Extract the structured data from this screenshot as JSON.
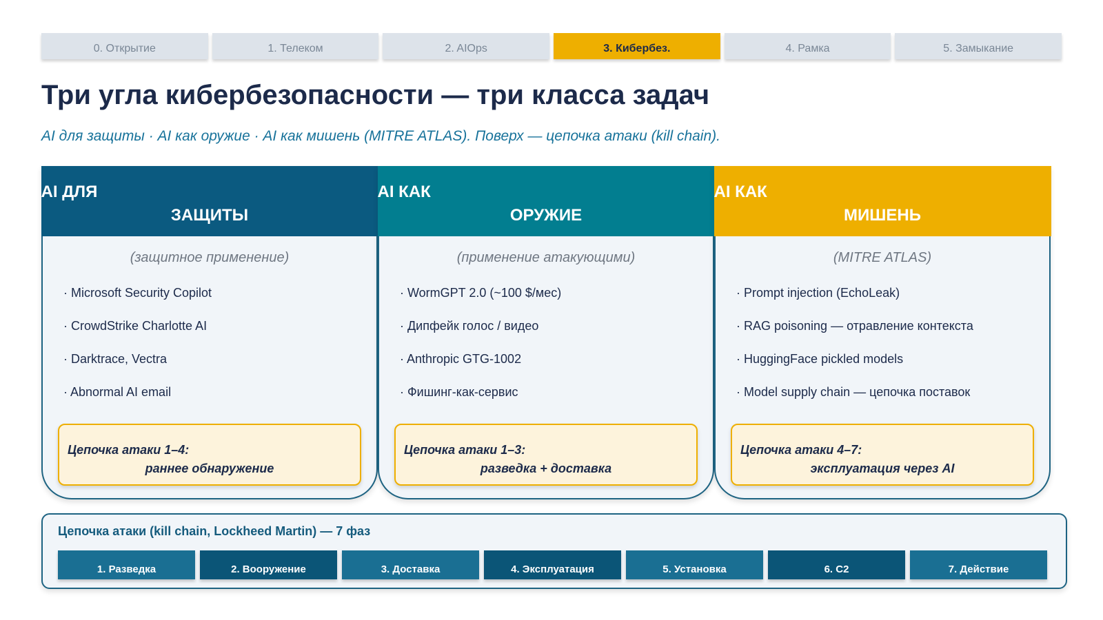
{
  "tabs": [
    {
      "label": "0. Открытие"
    },
    {
      "label": "1. Телеком"
    },
    {
      "label": "2. AIOps"
    },
    {
      "label": "3. Кибербез."
    },
    {
      "label": "4. Рамка"
    },
    {
      "label": "5. Замыкание"
    }
  ],
  "active_tab": "3. Кибербез.",
  "title": "Три угла кибербезопасности — три класса задач",
  "subtitle": "AI для защиты · AI как оружие · AI как мишень (MITRE ATLAS). Поверх — цепочка атаки (kill chain).",
  "cards": [
    {
      "head_line1": "AI ДЛЯ",
      "head_line2": "ЗАЩИТЫ",
      "color": "#0b5a80",
      "sub": "(защитное применение)",
      "items": [
        "· Microsoft Security Copilot",
        "· CrowdStrike Charlotte AI",
        "· Darktrace, Vectra",
        "· Abnormal AI email"
      ],
      "chain_line1": "Цепочка атаки 1–4:",
      "chain_line2": "раннее обнаружение"
    },
    {
      "head_line1": "AI КАК",
      "head_line2": "ОРУЖИЕ",
      "color": "#027e90",
      "sub": "(применение атакующими)",
      "items": [
        "· WormGPT 2.0 (~100 $/мес)",
        "· Дипфейк голос / видео",
        "· Anthropic GTG-1002",
        "· Фишинг-как-сервис"
      ],
      "chain_line1": "Цепочка атаки 1–3:",
      "chain_line2": "разведка + доставка"
    },
    {
      "head_line1": "AI КАК",
      "head_line2": "МИШЕНЬ",
      "color": "#eeaf00",
      "sub": "(MITRE ATLAS)",
      "items": [
        "· Prompt injection (EchoLeak)",
        "· RAG poisoning — отравление контекста",
        "· HuggingFace pickled models",
        "· Model supply chain — цепочка поставок"
      ],
      "chain_line1": "Цепочка атаки 4–7:",
      "chain_line2": "эксплуатация через AI"
    }
  ],
  "kill_chain": {
    "title": "Цепочка атаки (kill chain, Lockheed Martin) — 7 фаз",
    "phases": [
      {
        "label": "1. Разведка",
        "color": "#1a6f93"
      },
      {
        "label": "2. Вооружение",
        "color": "#0b5577"
      },
      {
        "label": "3. Доставка",
        "color": "#1a6f93"
      },
      {
        "label": "4. Эксплуатация",
        "color": "#0b5577"
      },
      {
        "label": "5. Установка",
        "color": "#1a6f93"
      },
      {
        "label": "6. C2",
        "color": "#0b5577"
      },
      {
        "label": "7. Действие",
        "color": "#1a6f93"
      }
    ]
  }
}
